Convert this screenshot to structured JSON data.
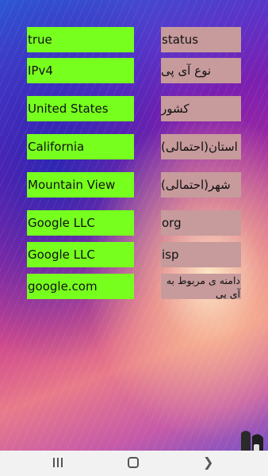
{
  "rows": [
    {
      "value": "true",
      "label": "status"
    },
    {
      "value": "IPv4",
      "label": "نوع آی پی"
    },
    {
      "value": "United States",
      "label": "کشور"
    },
    {
      "value": "California",
      "label": "استان(احتمالی)"
    },
    {
      "value": "Mountain View",
      "label": "شهر(احتمالی)"
    },
    {
      "value": "Google LLC",
      "label": "org"
    },
    {
      "value": "Google LLC",
      "label": "isp"
    },
    {
      "value": "google.com",
      "label": "دامنه ی مربوط به آی پی"
    }
  ],
  "icons": {
    "recent": "recent-apps-icon",
    "home": "home-icon",
    "back": "back-icon",
    "badge": "app-logo-icon"
  }
}
